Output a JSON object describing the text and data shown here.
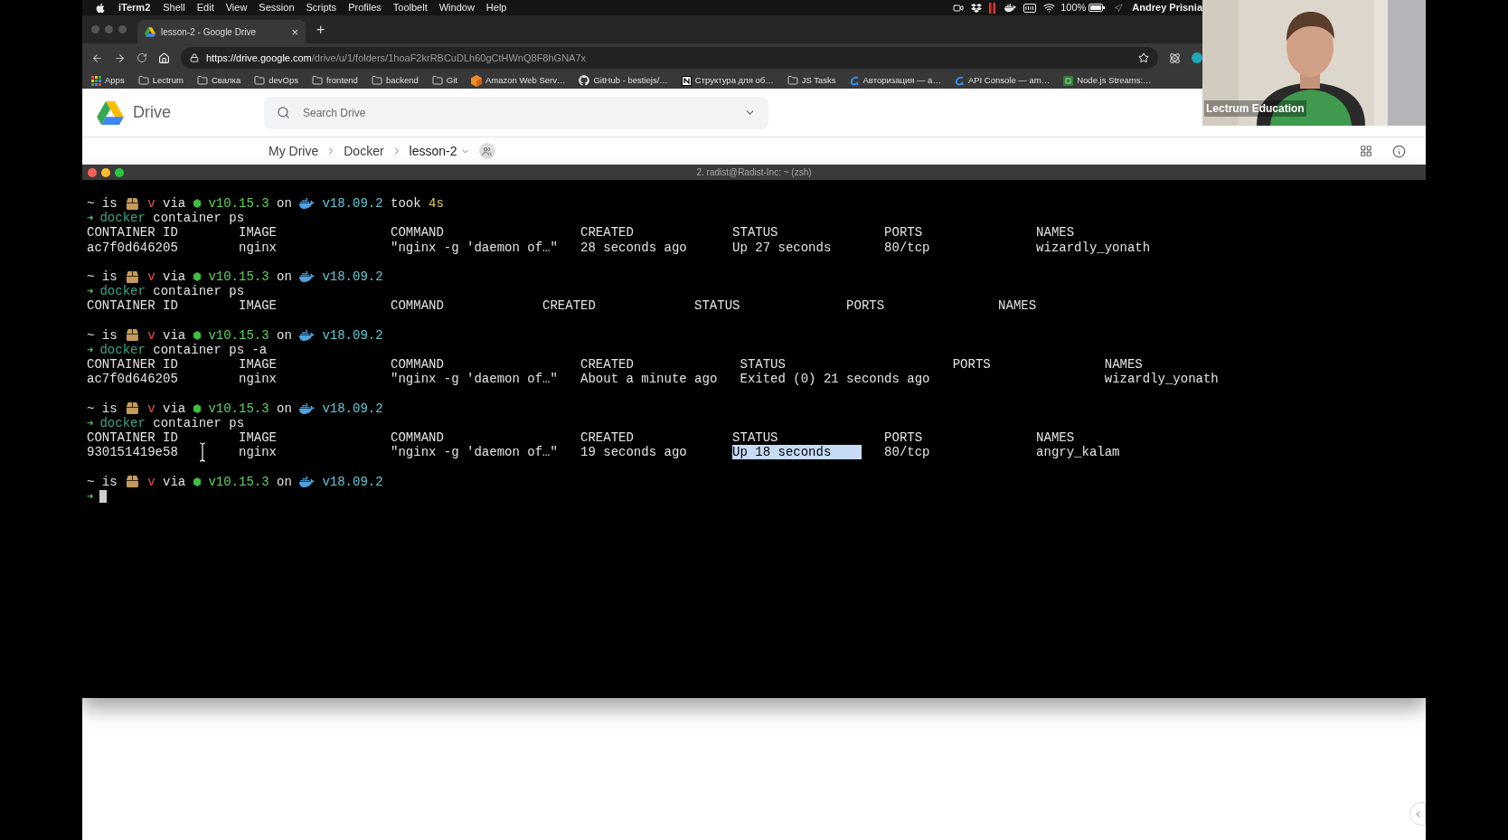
{
  "menu_bar": {
    "app": "iTerm2",
    "items": [
      "Shell",
      "Edit",
      "View",
      "Session",
      "Scripts",
      "Profiles",
      "Toolbelt",
      "Window",
      "Help"
    ],
    "battery": "100%",
    "user": "Andrey Prisnia"
  },
  "browser": {
    "tab": {
      "title": "lesson-2 - Google Drive",
      "close": "×"
    },
    "new_tab": "+",
    "url_host": "https://drive.google.com",
    "url_path": "/drive/u/1/folders/1hoaF2krRBCuDLh60gCtHWnQ8F8hGNA7x",
    "bookmarks": [
      {
        "label": "Apps",
        "kind": "apps"
      },
      {
        "label": "Lectrum",
        "kind": "folder"
      },
      {
        "label": "Свалка",
        "kind": "folder"
      },
      {
        "label": "devOps",
        "kind": "folder"
      },
      {
        "label": "frontend",
        "kind": "folder"
      },
      {
        "label": "backend",
        "kind": "folder"
      },
      {
        "label": "Git",
        "kind": "folder"
      },
      {
        "label": "Amazon Web Serv…",
        "kind": "cube"
      },
      {
        "label": "GitHub - bestiejs/…",
        "kind": "cat"
      },
      {
        "label": "Структура для об…",
        "kind": "square"
      },
      {
        "label": "JS Tasks",
        "kind": "folder"
      },
      {
        "label": "Авторизация — a…",
        "kind": "swoosh"
      },
      {
        "label": "API Console — am…",
        "kind": "swoosh"
      },
      {
        "label": "Node.js Streams:…",
        "kind": "node"
      }
    ]
  },
  "drive": {
    "logo": "Drive",
    "search": {
      "placeholder": "Search Drive"
    },
    "breadcrumbs": [
      "My Drive",
      "Docker",
      "lesson-2"
    ]
  },
  "terminal": {
    "title": "2. radist@Radist-Inc: ~ (zsh)",
    "blocks": [
      {
        "prompt": [
          {
            "kind": "text",
            "text": "~"
          },
          {
            "kind": "text",
            "text": "is"
          },
          {
            "kind": "box"
          },
          {
            "kind": "red",
            "text": "v"
          },
          {
            "kind": "text",
            "text": "via"
          },
          {
            "kind": "hexagon"
          },
          {
            "kind": "green",
            "text": "v10.15.3"
          },
          {
            "kind": "text",
            "text": "on"
          },
          {
            "kind": "whale"
          },
          {
            "kind": "cyan",
            "text": "v18.09.2"
          },
          {
            "kind": "text",
            "text": "took"
          },
          {
            "kind": "yellow",
            "text": "4s"
          }
        ],
        "command": {
          "arrow": "➜",
          "program": "docker",
          "args": "container ps"
        },
        "table": {
          "columns": [
            "CONTAINER ID",
            "IMAGE",
            "COMMAND",
            "CREATED",
            "STATUS",
            "PORTS",
            "NAMES"
          ],
          "rows": [
            [
              {
                "text": "ac7f0d646205",
                "selected": false
              },
              {
                "text": "nginx",
                "selected": false
              },
              {
                "text": "\"nginx -g 'daemon of…\"",
                "selected": false
              },
              {
                "text": "28 seconds ago",
                "selected": false
              },
              {
                "text": "Up 27 seconds",
                "selected": false
              },
              {
                "text": "80/tcp",
                "selected": false
              },
              {
                "text": "wizardly_yonath",
                "selected": false
              }
            ]
          ]
        }
      },
      {
        "prompt": [
          {
            "kind": "text",
            "text": "~"
          },
          {
            "kind": "text",
            "text": "is"
          },
          {
            "kind": "box"
          },
          {
            "kind": "red",
            "text": "v"
          },
          {
            "kind": "text",
            "text": "via"
          },
          {
            "kind": "hexagon"
          },
          {
            "kind": "green",
            "text": "v10.15.3"
          },
          {
            "kind": "text",
            "text": "on"
          },
          {
            "kind": "whale"
          },
          {
            "kind": "cyan",
            "text": "v18.09.2"
          }
        ],
        "command": {
          "arrow": "➜",
          "program": "docker",
          "args": "container ps"
        },
        "table": {
          "columns": [
            "CONTAINER ID",
            "IMAGE",
            "COMMAND",
            "CREATED",
            "STATUS",
            "PORTS",
            "NAMES"
          ]
        }
      },
      {
        "prompt": [
          {
            "kind": "text",
            "text": "~"
          },
          {
            "kind": "text",
            "text": "is"
          },
          {
            "kind": "box"
          },
          {
            "kind": "red",
            "text": "v"
          },
          {
            "kind": "text",
            "text": "via"
          },
          {
            "kind": "hexagon"
          },
          {
            "kind": "green",
            "text": "v10.15.3"
          },
          {
            "kind": "text",
            "text": "on"
          },
          {
            "kind": "whale"
          },
          {
            "kind": "cyan",
            "text": "v18.09.2"
          }
        ],
        "command": {
          "arrow": "➜",
          "program": "docker",
          "args": "container ps -a"
        },
        "table": {
          "columns": [
            "CONTAINER ID",
            "IMAGE",
            "COMMAND",
            "CREATED",
            "STATUS",
            "PORTS",
            "NAMES"
          ],
          "rows": [
            [
              {
                "text": "ac7f0d646205",
                "selected": false
              },
              {
                "text": "nginx",
                "selected": false
              },
              {
                "text": "\"nginx -g 'daemon of…\"",
                "selected": false
              },
              {
                "text": "About a minute ago",
                "selected": false
              },
              {
                "text": "Exited (0) 21 seconds ago",
                "selected": false
              },
              {
                "selected": false
              },
              {
                "text": "wizardly_yonath",
                "selected": false
              }
            ]
          ]
        }
      },
      {
        "prompt": [
          {
            "kind": "text",
            "text": "~"
          },
          {
            "kind": "text",
            "text": "is"
          },
          {
            "kind": "box"
          },
          {
            "kind": "red",
            "text": "v"
          },
          {
            "kind": "text",
            "text": "via"
          },
          {
            "kind": "hexagon"
          },
          {
            "kind": "green",
            "text": "v10.15.3"
          },
          {
            "kind": "text",
            "text": "on"
          },
          {
            "kind": "whale"
          },
          {
            "kind": "cyan",
            "text": "v18.09.2"
          }
        ],
        "command": {
          "arrow": "➜",
          "program": "docker",
          "args": "container ps"
        },
        "table": {
          "columns": [
            "CONTAINER ID",
            "IMAGE",
            "COMMAND",
            "CREATED",
            "STATUS",
            "PORTS",
            "NAMES"
          ],
          "rows": [
            [
              {
                "text": "930151419e58",
                "selected": false
              },
              {
                "text": "nginx",
                "selected": false
              },
              {
                "text": "\"nginx -g 'daemon of…\"",
                "selected": false
              },
              {
                "text": "19 seconds ago",
                "selected": false
              },
              {
                "text": "Up 18 seconds",
                "selected": true
              },
              {
                "text": "80/tcp",
                "selected": false
              },
              {
                "text": "angry_kalam",
                "selected": false
              }
            ]
          ]
        }
      },
      {
        "prompt": [
          {
            "kind": "text",
            "text": "~"
          },
          {
            "kind": "text",
            "text": "is"
          },
          {
            "kind": "box"
          },
          {
            "kind": "red",
            "text": "v"
          },
          {
            "kind": "text",
            "text": "via"
          },
          {
            "kind": "hexagon"
          },
          {
            "kind": "green",
            "text": "v10.15.3"
          },
          {
            "kind": "text",
            "text": "on"
          },
          {
            "kind": "whale"
          },
          {
            "kind": "cyan",
            "text": "v18.09.2"
          }
        ],
        "command": {
          "arrow": "➜"
        }
      }
    ]
  },
  "webcam": {
    "kind": "picture",
    "label": "Lectrum Education"
  }
}
